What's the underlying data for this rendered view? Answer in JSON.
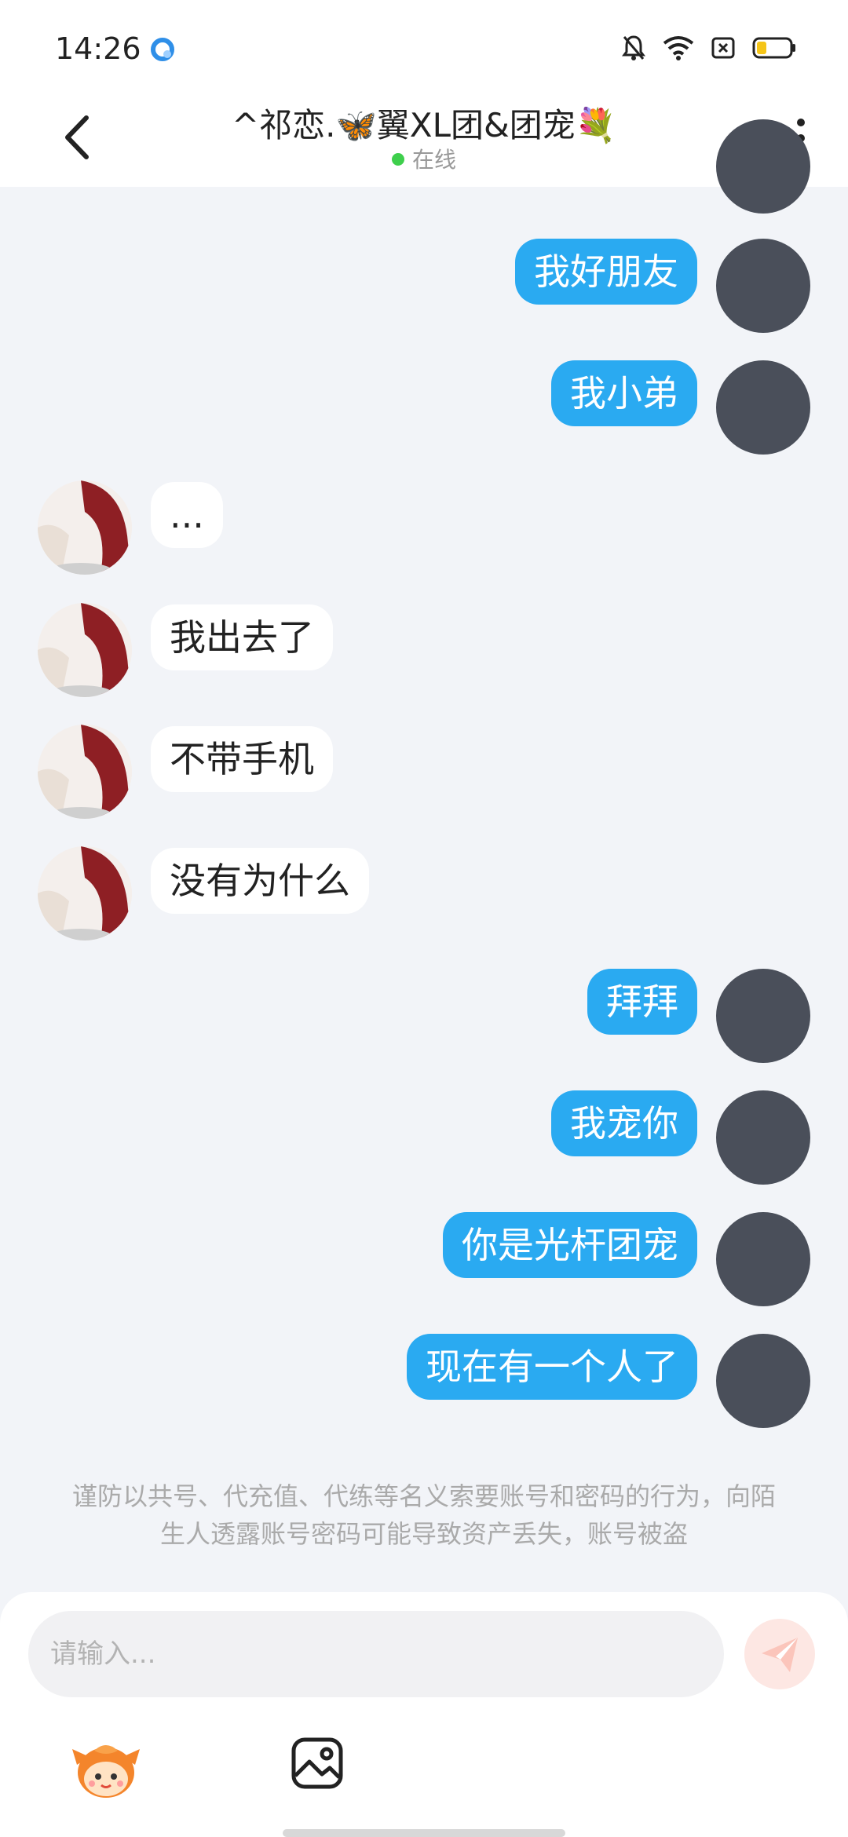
{
  "status_bar": {
    "time": "14:26"
  },
  "header": {
    "title": "^祁恋.🦋翼XL团&团宠💐",
    "status": "在线"
  },
  "messages": [
    {
      "side": "mine",
      "text": "我好朋友"
    },
    {
      "side": "mine",
      "text": "我小弟"
    },
    {
      "side": "theirs",
      "text": "..."
    },
    {
      "side": "theirs",
      "text": "我出去了"
    },
    {
      "side": "theirs",
      "text": "不带手机"
    },
    {
      "side": "theirs",
      "text": "没有为什么"
    },
    {
      "side": "mine",
      "text": "拜拜"
    },
    {
      "side": "mine",
      "text": "我宠你"
    },
    {
      "side": "mine",
      "text": "你是光杆团宠"
    },
    {
      "side": "mine",
      "text": "现在有一个人了"
    }
  ],
  "warning": "谨防以共号、代充值、代练等名义索要账号和密码的行为，向陌生人透露账号密码可能导致资产丢失，账号被盗",
  "input": {
    "placeholder": "请输入..."
  },
  "colors": {
    "my_bubble": "#2aaaf1",
    "their_bubble": "#ffffff",
    "online_dot": "#3ecf4c",
    "background": "#f2f4f8"
  }
}
